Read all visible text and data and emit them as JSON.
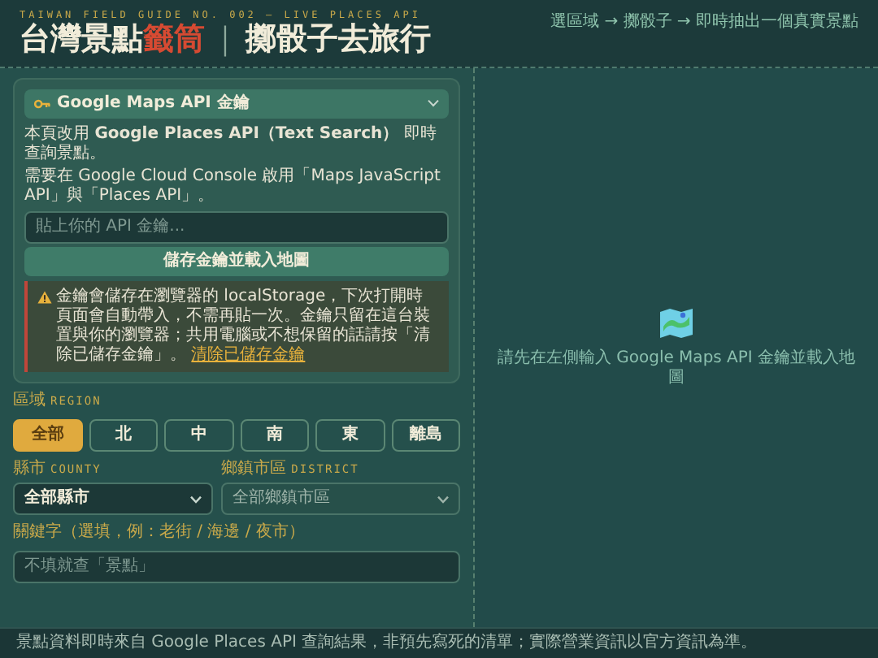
{
  "header": {
    "kicker": "TAIWAN FIELD GUIDE NO. 002 — LIVE PLACES API",
    "title": "台灣景點",
    "title_accent": "籤筒",
    "title_divider": "｜",
    "subtitle": "擲骰子去旅行",
    "steps": "選區域 → 擲骰子 → 即時抽出一個真實景點"
  },
  "api_card": {
    "title": "Google Maps API 金鑰",
    "expanded": true,
    "intro": "本頁改用 **Google Places API（Text Search）** 即時查詢景點。",
    "requirement": "需要在 Google Cloud Console 啟用「Maps JavaScript API」與「Places API」。",
    "input": {
      "placeholder": "貼上你的 API 金鑰..."
    },
    "button": "儲存金鑰並載入地圖",
    "warning": "金鑰會儲存在瀏覽器的 localStorage，下次打開時頁面會自動帶入，不需再貼一次。金鑰只留在這台裝置與你的瀏覽器；共用電腦或不想保留的話請按「清除已儲存金鑰」。",
    "warning_link": "清除已儲存金鑰"
  },
  "region": {
    "label": "區域",
    "sublabel": "REGION",
    "options": [
      {
        "label": "全部",
        "selected": true
      },
      {
        "label": "北",
        "selected": false
      },
      {
        "label": "中",
        "selected": false
      },
      {
        "label": "南",
        "selected": false
      },
      {
        "label": "東",
        "selected": false
      },
      {
        "label": "離島",
        "selected": false
      }
    ]
  },
  "county": {
    "label": "縣市",
    "sublabel": "COUNTY",
    "value": "全部縣市",
    "disabled": false
  },
  "district": {
    "label": "鄉鎮市區",
    "sublabel": "DISTRICT",
    "value": "全部鄉鎮市區",
    "disabled": true
  },
  "keyword": {
    "label": "關鍵字（選填，例：老街 / 海邊 / 夜市）",
    "placeholder": "不填就查「景點」"
  },
  "map": {
    "message": "請先在左側輸入 Google Maps API 金鑰並載入地圖"
  },
  "footer": "景點資料即時來自 Google Places API 查詢結果，非預先寫死的清單；實際營業資訊以官方資訊為準。"
}
